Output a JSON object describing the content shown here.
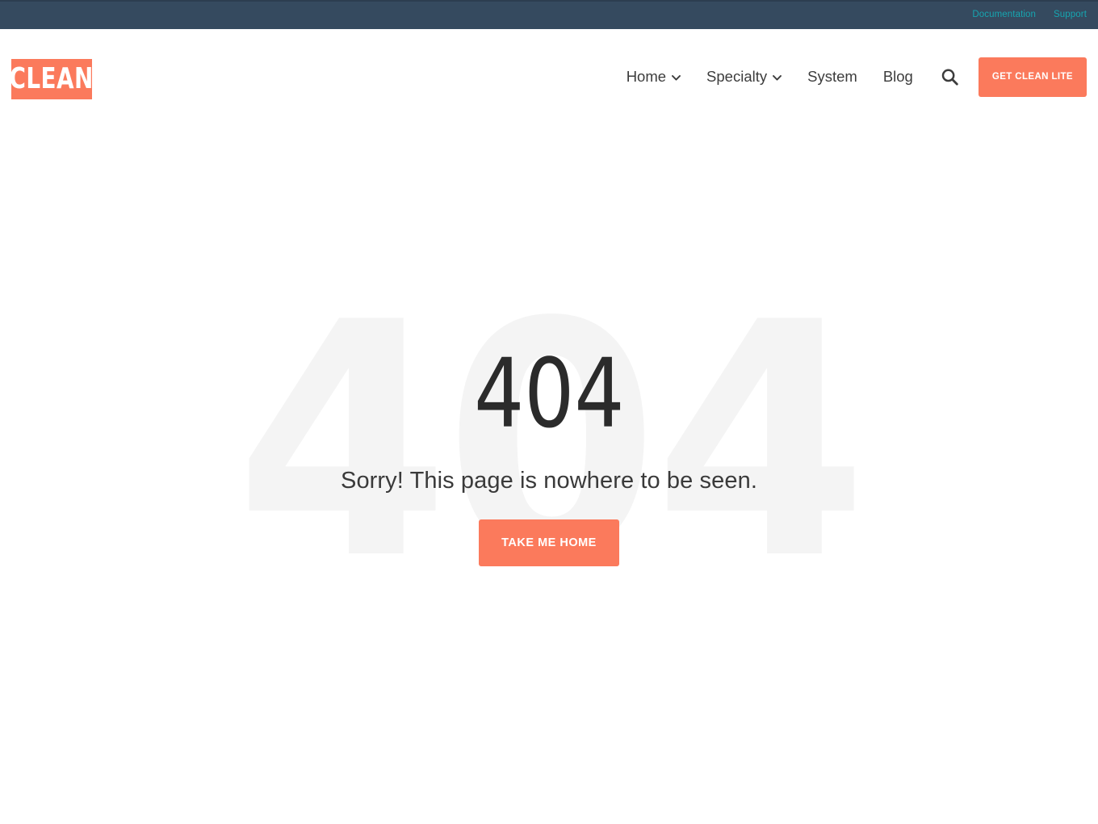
{
  "topbar": {
    "links": [
      {
        "label": "Documentation"
      },
      {
        "label": "Support"
      }
    ],
    "background_color": "#354a5f",
    "link_color": "#16a5b0"
  },
  "header": {
    "logo": {
      "text": "CLEAN",
      "background_color": "#fb7a5c",
      "text_color": "#ffffff"
    },
    "nav": [
      {
        "label": "Home",
        "has_dropdown": true,
        "icon": "chevron-down-icon"
      },
      {
        "label": "Specialty",
        "has_dropdown": true,
        "icon": "chevron-down-icon"
      },
      {
        "label": "System",
        "has_dropdown": false
      },
      {
        "label": "Blog",
        "has_dropdown": false
      }
    ],
    "search": {
      "icon": "search-icon"
    },
    "cta": {
      "label": "GET CLEAN LITE",
      "background_color": "#fb7a5c",
      "text_color": "#ffffff"
    }
  },
  "hero": {
    "watermark": "404",
    "watermark_color": "#f4f4f4",
    "code": "404",
    "code_color": "#2b2b2b",
    "message": "Sorry! This page is nowhere to be seen.",
    "button": {
      "label": "TAKE ME HOME",
      "background_color": "#fb7a5c",
      "text_color": "#ffffff"
    }
  }
}
